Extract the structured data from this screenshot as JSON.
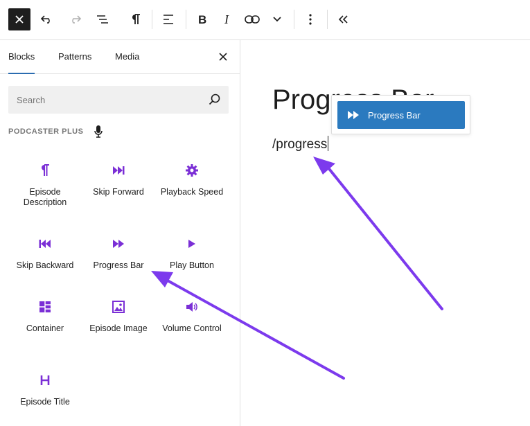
{
  "toolbar": {
    "close_label": "Close",
    "undo_label": "Undo",
    "redo_label": "Redo",
    "list_view_label": "Document overview",
    "paragraph_label": "Paragraph",
    "align_label": "Align text",
    "bold_label": "Bold",
    "italic_label": "Italic",
    "link_label": "Link",
    "more_formatting_label": "More",
    "options_label": "Options",
    "collapse_label": "Collapse"
  },
  "inserter": {
    "tabs": [
      {
        "label": "Blocks",
        "active": true
      },
      {
        "label": "Patterns",
        "active": false
      },
      {
        "label": "Media",
        "active": false
      }
    ],
    "search": {
      "placeholder": "Search",
      "value": ""
    },
    "category": {
      "title": "PODCASTER PLUS",
      "icon": "microphone-icon"
    },
    "blocks": [
      {
        "label": "Episode Description",
        "icon": "paragraph-icon"
      },
      {
        "label": "Skip Forward",
        "icon": "skip-forward-icon"
      },
      {
        "label": "Playback Speed",
        "icon": "gear-icon"
      },
      {
        "label": "Skip Backward",
        "icon": "skip-backward-icon"
      },
      {
        "label": "Progress Bar",
        "icon": "fast-forward-icon"
      },
      {
        "label": "Play Button",
        "icon": "play-icon"
      },
      {
        "label": "Container",
        "icon": "container-icon"
      },
      {
        "label": "Episode Image",
        "icon": "image-icon"
      },
      {
        "label": "Volume Control",
        "icon": "volume-icon"
      },
      {
        "label": "Episode Title",
        "icon": "heading-icon"
      }
    ]
  },
  "editor": {
    "heading": "Progress Bar",
    "paragraph": "/progress"
  },
  "autocomplete": {
    "item_label": "Progress Bar",
    "item_icon": "fast-forward-icon"
  },
  "colors": {
    "accent_purple": "#7b2fd6",
    "arrow_purple": "#7c3aed",
    "suggestion_blue": "#2b7abf",
    "tab_underline": "#2b6cb0"
  }
}
